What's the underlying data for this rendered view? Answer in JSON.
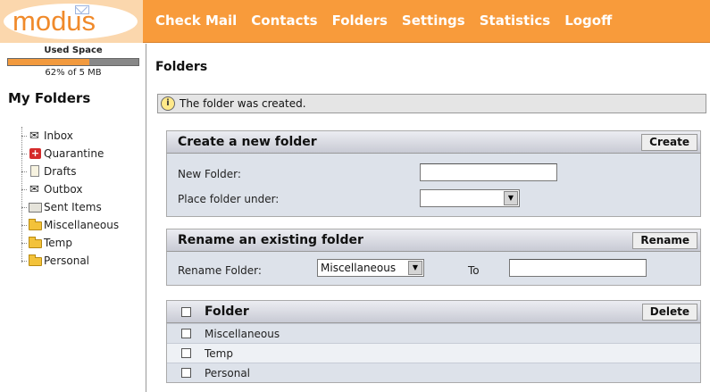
{
  "app": {
    "logo": "modus",
    "nav": [
      "Check Mail",
      "Contacts",
      "Folders",
      "Settings",
      "Statistics",
      "Logoff"
    ]
  },
  "sidebar": {
    "used_space_label": "Used Space",
    "used_space_fraction": 0.62,
    "used_space_text": "62% of 5 MB",
    "title": "My Folders",
    "folders": [
      {
        "label": "Inbox",
        "icon": "inbox-icon"
      },
      {
        "label": "Quarantine",
        "icon": "quarantine-icon"
      },
      {
        "label": "Drafts",
        "icon": "drafts-icon"
      },
      {
        "label": "Outbox",
        "icon": "outbox-icon"
      },
      {
        "label": "Sent Items",
        "icon": "sent-items-icon"
      },
      {
        "label": "Miscellaneous",
        "icon": "folder-icon"
      },
      {
        "label": "Temp",
        "icon": "folder-icon"
      },
      {
        "label": "Personal",
        "icon": "folder-icon"
      }
    ]
  },
  "main": {
    "title": "Folders",
    "notice": "The folder was created.",
    "create": {
      "title": "Create a new folder",
      "button": "Create",
      "new_folder_label": "New Folder:",
      "new_folder_value": "",
      "place_under_label": "Place folder under:",
      "place_under_value": ""
    },
    "rename": {
      "title": "Rename an existing folder",
      "button": "Rename",
      "rename_label": "Rename Folder:",
      "rename_value": "Miscellaneous",
      "to_label": "To",
      "to_value": ""
    },
    "list": {
      "header": "Folder",
      "button": "Delete",
      "rows": [
        "Miscellaneous",
        "Temp",
        "Personal"
      ]
    }
  },
  "colors": {
    "topbar": "#f89b3b",
    "used_fill": "#f29a3e",
    "panel_body": "#dde2ea"
  }
}
